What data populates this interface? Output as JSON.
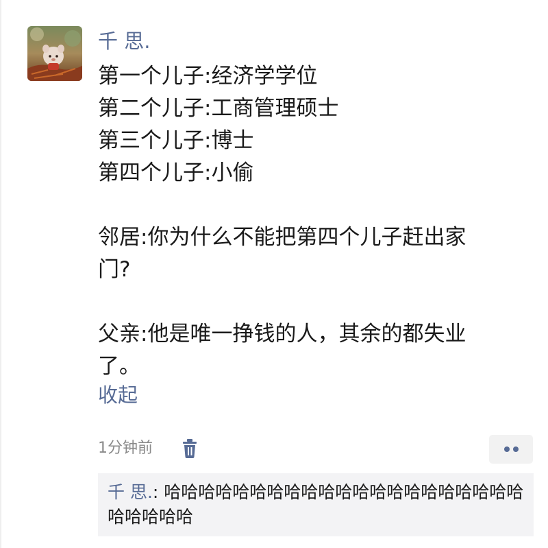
{
  "post": {
    "username": "千 思.",
    "lines": [
      "第一个儿子:经济学学位",
      "第二个儿子:工商管理硕士",
      "第三个儿子:博士",
      "第四个儿子:小偷",
      "",
      "邻居:你为什么不能把第四个儿子赶出家",
      "门?",
      "",
      "父亲:他是唯一挣钱的人，其余的都失业",
      "了。"
    ],
    "collapse_label": "收起",
    "timestamp": "1分钟前"
  },
  "icons": {
    "avatar": "avatar-image",
    "delete": "trash-icon",
    "more": "more-dots-icon"
  },
  "comment": {
    "author": "千 思.",
    "separator": ": ",
    "text": "哈哈哈哈哈哈哈哈哈哈哈哈哈哈哈哈哈哈哈哈哈哈哈哈哈哈"
  },
  "colors": {
    "link": "#576b95",
    "text": "#1a1a1a",
    "muted": "#8a8a8a",
    "comment_bg": "#f3f3f5"
  }
}
